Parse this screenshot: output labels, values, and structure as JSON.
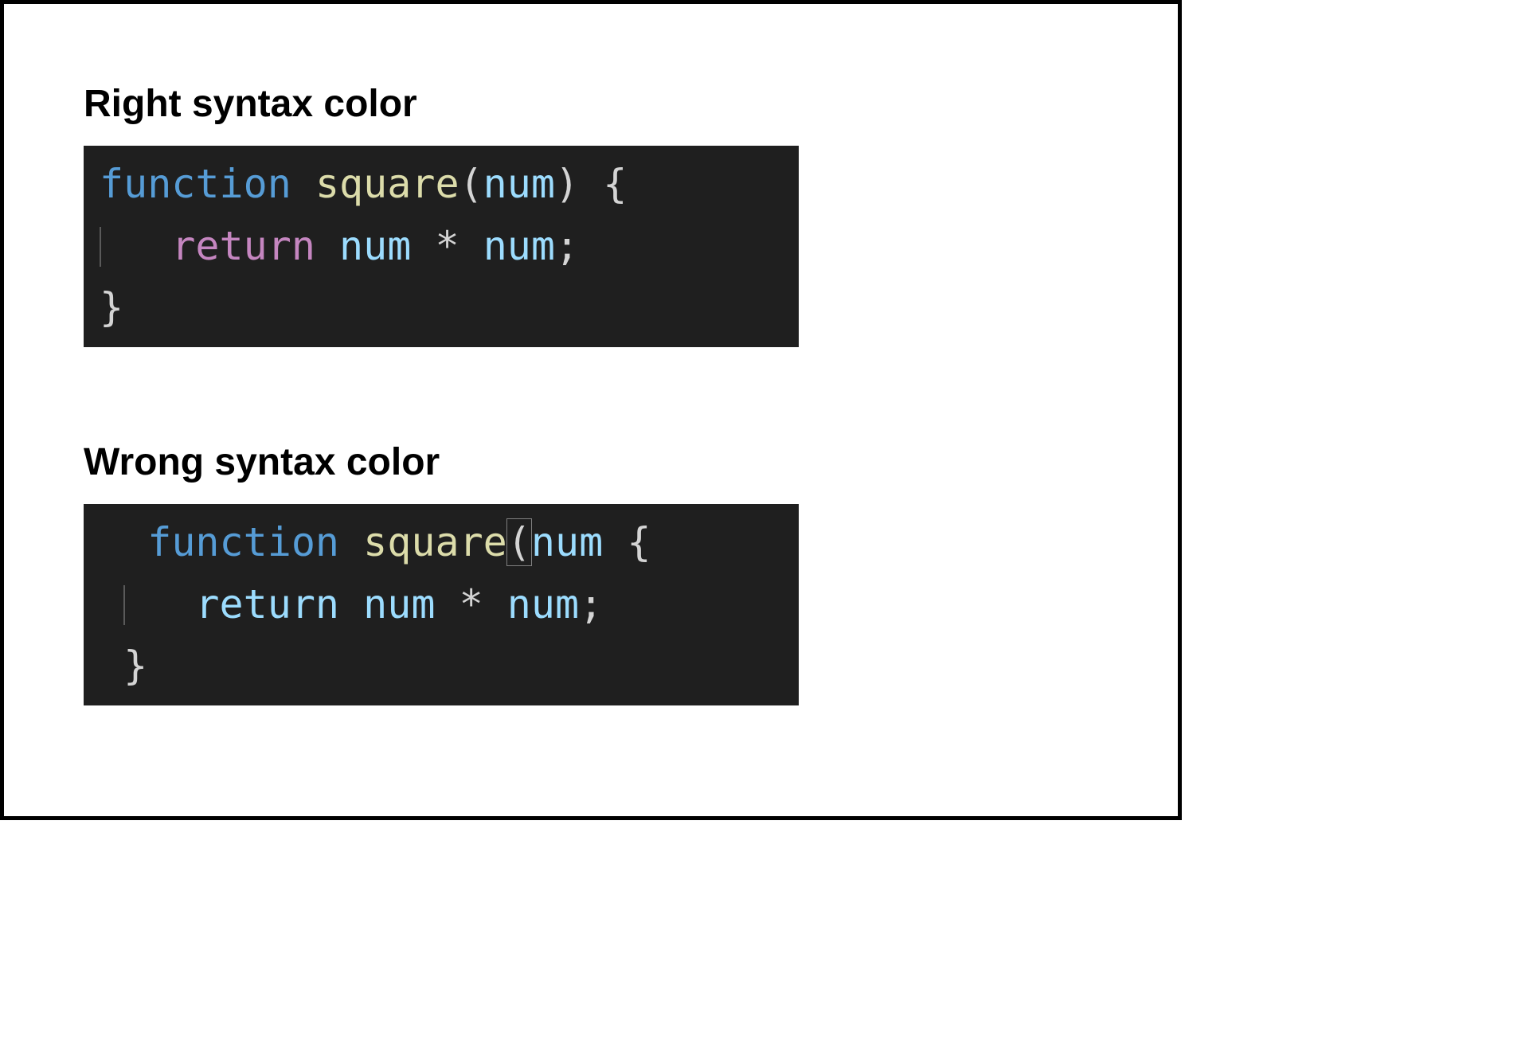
{
  "sections": {
    "right": {
      "heading": "Right syntax color",
      "code": {
        "kw_function": "function",
        "fn_name": "square",
        "paren_open": "(",
        "param": "num",
        "paren_close": ")",
        "brace_open": "{",
        "kw_return": "return",
        "ident1": "num",
        "op": "*",
        "ident2": "num",
        "semicolon": ";",
        "brace_close": "}"
      }
    },
    "wrong": {
      "heading": "Wrong syntax color",
      "code": {
        "kw_function": "function",
        "fn_name": "square",
        "paren_open": "(",
        "param": "num",
        "brace_open": "{",
        "kw_return": "return",
        "ident1": "num",
        "op": "*",
        "ident2": "num",
        "semicolon": ";",
        "brace_close": "}"
      }
    }
  },
  "colors": {
    "keyword": "#569cd6",
    "function_name": "#dcdcaa",
    "parameter": "#9cdcfe",
    "control_flow": "#c586c0",
    "punctuation": "#d4d4d4",
    "editor_bg": "#1f1f1f"
  }
}
